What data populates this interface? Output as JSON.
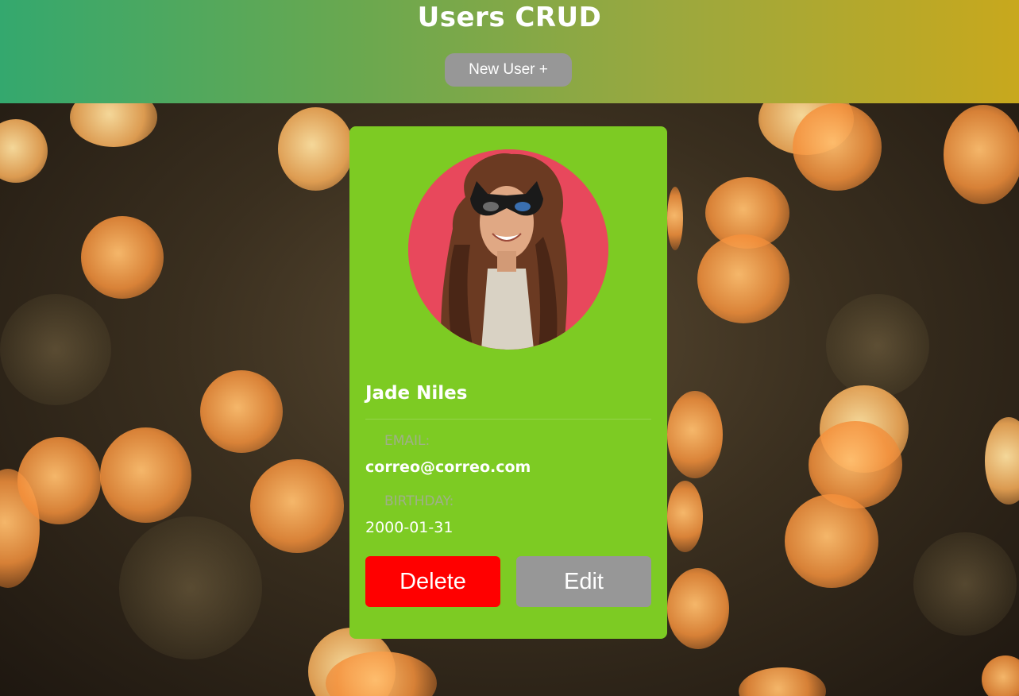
{
  "header": {
    "title": "Users CRUD",
    "new_user_label": "New User +"
  },
  "user_card": {
    "name": "Jade Niles",
    "email_label": "EMAIL:",
    "email": "correo@correo.com",
    "birthday_label": "BIRTHDAY:",
    "birthday": "2000-01-31",
    "delete_label": "Delete",
    "edit_label": "Edit"
  },
  "colors": {
    "card_background": "#7dcb23",
    "avatar_background": "#e8485c",
    "delete_button": "#ff0000",
    "neutral_button": "#979797"
  }
}
